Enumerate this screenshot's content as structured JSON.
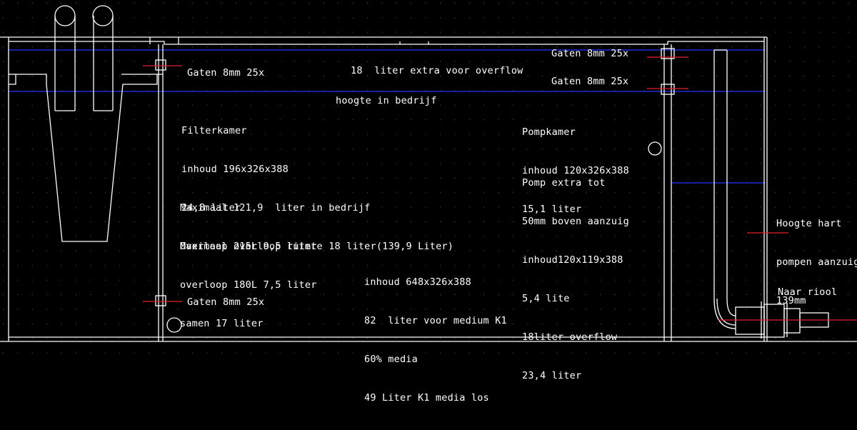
{
  "colors": {
    "background": "#000000",
    "lines": "#ffffff",
    "water_level": "#1f2bd6",
    "markers": "#e0202a",
    "grid_dots": "#5a5a5a"
  },
  "labels": {
    "holes_top_left": "Gaten 8mm 25x",
    "holes_bottom_left": "Gaten 8mm 25x",
    "holes_top_right": "Gaten 8mm 25x",
    "holes_mid_right": "Gaten 8mm 25x",
    "overflow_extra": "18  liter extra voor overflow",
    "operating_height": "hoogte in bedrijf",
    "filter_chamber": [
      "Filterkamer",
      "inhoud 196x326x388",
      "24,8 liter"
    ],
    "max_operating": [
      "Maximaal 121,9  liter in bedrijf",
      "Maximaal overloop ruimte 18 liter(139,9 Liter)"
    ],
    "overflow_volumes": [
      "Overloop 215L 9,5 liter",
      "overloop 180L 7,5 liter",
      "samen 17 liter"
    ],
    "media_volume": [
      "inhoud 648x326x388",
      "82  liter voor medium K1",
      "60% media",
      "49 Liter K1 media los"
    ],
    "pump_chamber": [
      "Pompkamer",
      "inhoud 120x326x388",
      "15,1 liter"
    ],
    "pump_extra": [
      "Pomp extra tot",
      "50mm boven aanzuig",
      "inhoud120x119x388",
      "5,4 lite",
      "18liter overflow",
      "23,4 liter"
    ],
    "pump_center_height": [
      "Hoogte hart",
      "pompen aanzuig",
      "139mm"
    ],
    "to_sewer": "Naar riool"
  }
}
